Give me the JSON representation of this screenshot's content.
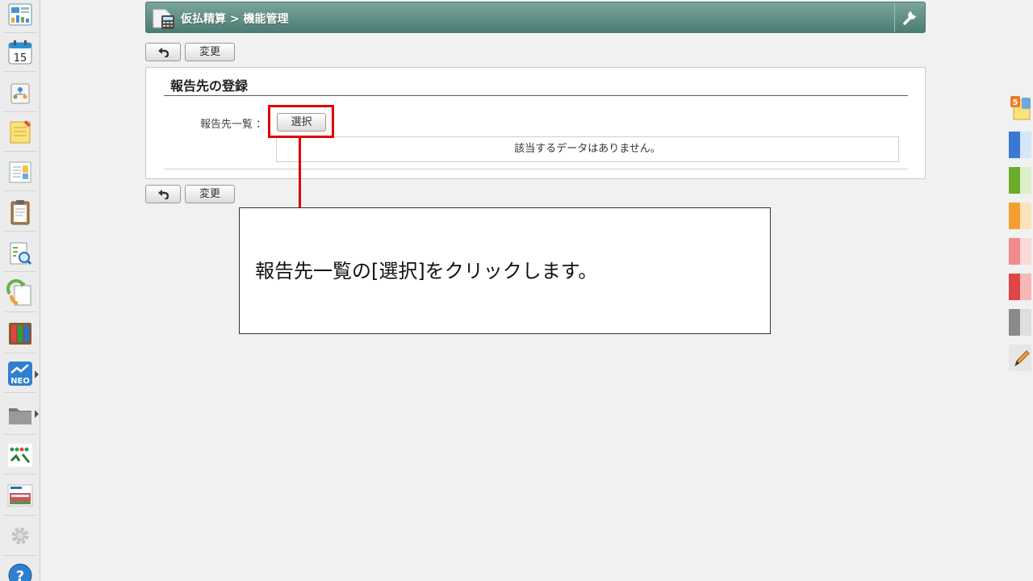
{
  "header": {
    "title": "仮払精算 > 機能管理",
    "app_icon": "calculator-app-icon",
    "tool_icon": "wrench-icon"
  },
  "toolbar_top": {
    "back_icon": "back-arrow-icon",
    "change_label": "変更"
  },
  "toolbar_bottom": {
    "back_icon": "back-arrow-icon",
    "change_label": "変更"
  },
  "section": {
    "title": "報告先の登録",
    "field_label": "報告先一覧 ：",
    "select_label": "選択",
    "empty_message": "該当するデータはありません。"
  },
  "annotation": {
    "text": "報告先一覧の[選択]をクリックします。",
    "color": "#e00000"
  },
  "sidebar": {
    "items": [
      {
        "icon": "portal-icon"
      },
      {
        "icon": "calendar-icon",
        "day": "15"
      },
      {
        "icon": "org-chart-icon"
      },
      {
        "icon": "memo-icon"
      },
      {
        "icon": "bulletin-board-icon"
      },
      {
        "icon": "clipboard-icon"
      },
      {
        "icon": "search-document-icon"
      },
      {
        "icon": "workflow-icon"
      },
      {
        "icon": "binders-icon"
      },
      {
        "icon": "neo-chart-icon",
        "label": "NEO"
      },
      {
        "icon": "folder-icon"
      },
      {
        "icon": "app-logo-icon"
      },
      {
        "icon": "bus-banner-icon"
      },
      {
        "icon": "settings-gear-icon"
      },
      {
        "icon": "help-icon",
        "label": "?"
      }
    ]
  },
  "right_tabs": {
    "notification_count": "5",
    "colors": [
      "#3a78d4",
      "#6aab2c",
      "#f3a033",
      "#f28b8b",
      "#e04545",
      "#8a8a8a"
    ]
  }
}
